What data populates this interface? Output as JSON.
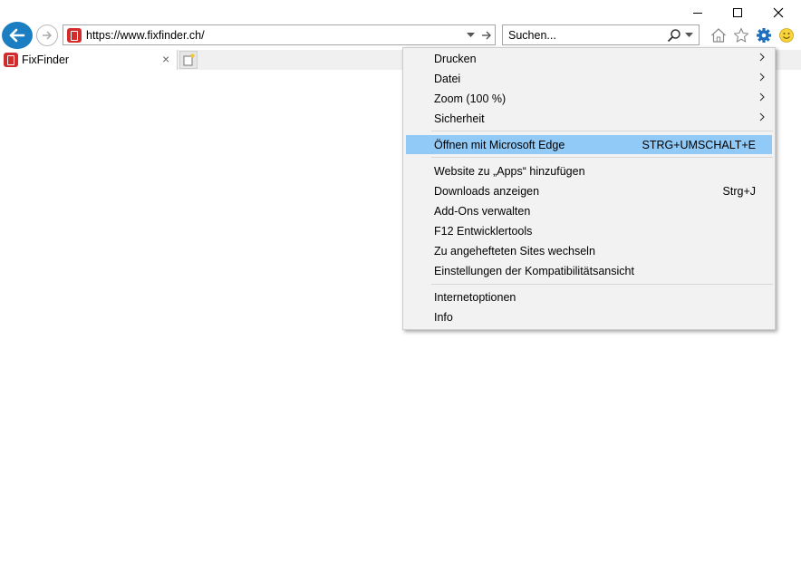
{
  "browser": {
    "url": "https://www.fixfinder.ch/",
    "search_placeholder": "Suchen..."
  },
  "tab": {
    "title": "FixFinder",
    "close_glyph": "×"
  },
  "menu": {
    "items": [
      {
        "label": "Drucken",
        "submenu": true
      },
      {
        "label": "Datei",
        "submenu": true
      },
      {
        "label": "Zoom (100 %)",
        "submenu": true
      },
      {
        "label": "Sicherheit",
        "submenu": true
      },
      {
        "label": "Öffnen mit Microsoft Edge",
        "shortcut": "STRG+UMSCHALT+E",
        "highlighted": true
      },
      {
        "label": "Website zu „Apps“ hinzufügen"
      },
      {
        "label": "Downloads anzeigen",
        "shortcut": "Strg+J"
      },
      {
        "label": "Add-Ons verwalten"
      },
      {
        "label": "F12 Entwicklertools"
      },
      {
        "label": "Zu angehefteten Sites wechseln"
      },
      {
        "label": "Einstellungen der Kompatibilitätsansicht"
      },
      {
        "label": "Internetoptionen"
      },
      {
        "label": "Info"
      }
    ]
  },
  "colors": {
    "accent": "#1b7ec3",
    "favicon": "#d22c2c",
    "highlight": "#91c9f7",
    "gear": "#1e6fbf"
  },
  "icons": [
    "back-arrow-icon",
    "forward-arrow-icon",
    "home-icon",
    "star-icon",
    "gear-icon",
    "smiley-icon",
    "search-icon",
    "new-tab-icon"
  ]
}
